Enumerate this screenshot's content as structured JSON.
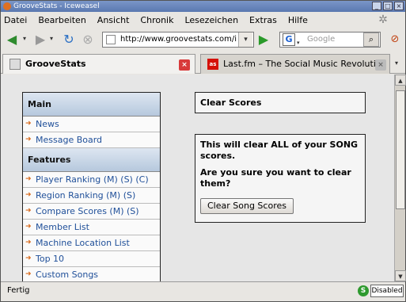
{
  "window": {
    "title": "GrooveStats - Iceweasel"
  },
  "menubar": {
    "items": [
      "Datei",
      "Bearbeiten",
      "Ansicht",
      "Chronik",
      "Lesezeichen",
      "Extras",
      "Hilfe"
    ]
  },
  "toolbar": {
    "url": "http://www.groovestats.com/i",
    "search_placeholder": "Google"
  },
  "tabs": [
    {
      "label": "GrooveStats",
      "active": true
    },
    {
      "label": "Last.fm – The Social Music Revolution",
      "active": false
    }
  ],
  "sidebar": {
    "sections": [
      {
        "title": "Main",
        "links": [
          "News",
          "Message Board"
        ]
      },
      {
        "title": "Features",
        "links": [
          "Player Ranking (M) (S) (C)",
          "Region Ranking (M) (S)",
          "Compare Scores (M) (S)",
          "Member List",
          "Machine Location List",
          "Top 10",
          "Custom Songs"
        ]
      }
    ]
  },
  "main": {
    "title": "Clear Scores",
    "message_line1": "This will clear ALL of your SONG scores.",
    "message_line2": "Are you sure you want to clear them?",
    "button_label": "Clear Song Scores"
  },
  "statusbar": {
    "text": "Fertig",
    "noscript_label": "Disabled"
  },
  "colors": {
    "link": "#1f4f99",
    "section_header": "#c6d5e8",
    "tab_close_active": "#d83a3a"
  }
}
